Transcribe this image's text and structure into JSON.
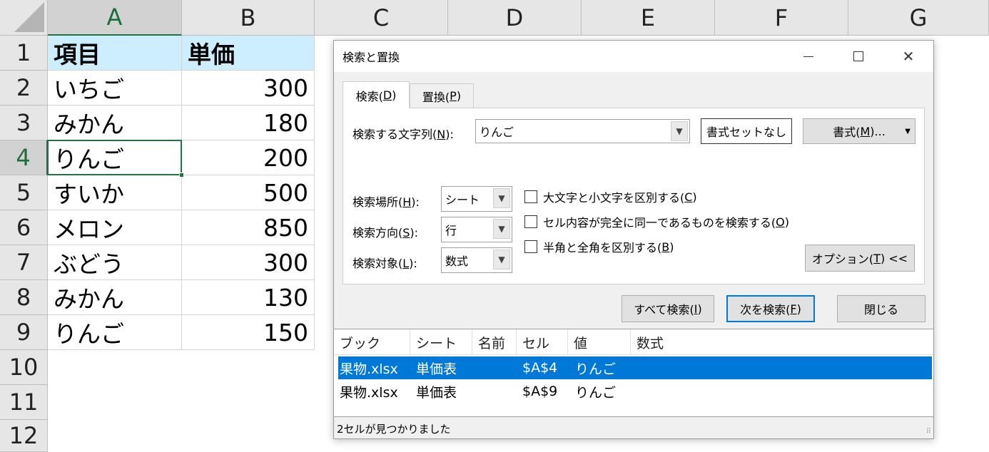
{
  "sheet": {
    "columns": [
      "A",
      "B",
      "C",
      "D",
      "E",
      "F",
      "G"
    ],
    "rows": [
      "1",
      "2",
      "3",
      "4",
      "5",
      "6",
      "7",
      "8",
      "9",
      "10",
      "11",
      "12"
    ],
    "header": {
      "item": "項目",
      "price": "単価"
    },
    "data": [
      {
        "item": "いちご",
        "price": "300"
      },
      {
        "item": "みかん",
        "price": "180"
      },
      {
        "item": "りんご",
        "price": "200"
      },
      {
        "item": "すいか",
        "price": "500"
      },
      {
        "item": "メロン",
        "price": "850"
      },
      {
        "item": "ぶどう",
        "price": "300"
      },
      {
        "item": "みかん",
        "price": "130"
      },
      {
        "item": "りんご",
        "price": "150"
      }
    ],
    "active_cell": "A4",
    "accent_color": "#217346",
    "header_fill_color": "#cdeeff"
  },
  "dialog": {
    "title": "検索と置換",
    "tabs": {
      "find_prefix": "検索(",
      "find_key": "D",
      "find_suffix": ")",
      "replace_prefix": "置換(",
      "replace_key": "P",
      "replace_suffix": ")"
    },
    "search_label_prefix": "検索する文字列(",
    "search_label_key": "N",
    "search_label_suffix": "):",
    "search_value": "りんご",
    "no_format_button": "書式セットなし",
    "format_button_prefix": "書式(",
    "format_button_key": "M",
    "format_button_suffix": ")...",
    "within_label_prefix": "検索場所(",
    "within_label_key": "H",
    "within_label_suffix": "):",
    "within_value": "シート",
    "search_dir_label_prefix": "検索方向(",
    "search_dir_label_key": "S",
    "search_dir_label_suffix": "):",
    "search_dir_value": "行",
    "look_in_label_prefix": "検索対象(",
    "look_in_label_key": "L",
    "look_in_label_suffix": "):",
    "look_in_value": "数式",
    "match_case_prefix": "大文字と小文字を区別する(",
    "match_case_key": "C",
    "match_case_suffix": ")",
    "match_entire_prefix": "セル内容が完全に同一であるものを検索する(",
    "match_entire_key": "O",
    "match_entire_suffix": ")",
    "match_byte_prefix": "半角と全角を区別する(",
    "match_byte_key": "B",
    "match_byte_suffix": ")",
    "options_prefix": "オプション(",
    "options_key": "T",
    "options_suffix": ") <<",
    "find_all_prefix": "すべて検索(",
    "find_all_key": "I",
    "find_all_suffix": ")",
    "find_next_prefix": "次を検索(",
    "find_next_key": "F",
    "find_next_suffix": ")",
    "close_button": "閉じる",
    "results": {
      "columns": [
        "ブック",
        "シート",
        "名前",
        "セル",
        "値",
        "数式"
      ],
      "rows": [
        {
          "book": "果物.xlsx",
          "sheet": "単価表",
          "name": "",
          "cell": "$A$4",
          "value": "りんご",
          "formula": ""
        },
        {
          "book": "果物.xlsx",
          "sheet": "単価表",
          "name": "",
          "cell": "$A$9",
          "value": "りんご",
          "formula": ""
        }
      ]
    },
    "status": "2セルが見つかりました",
    "selection_color": "#0078d7"
  }
}
